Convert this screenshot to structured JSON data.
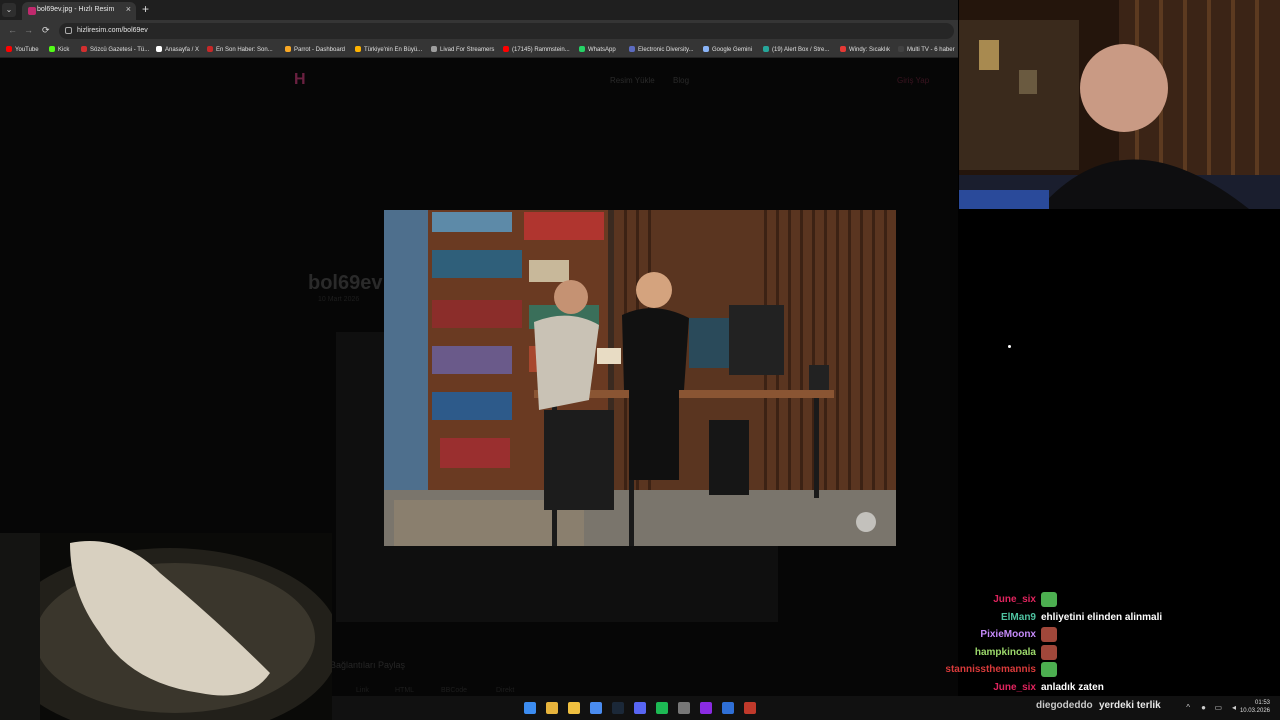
{
  "browser": {
    "tab_title": "bol69ev.jpg - Hızlı Resim",
    "tab_close": "×",
    "new_tab": "+",
    "tab_list": "⌄",
    "url": "hizliresim.com/bol69ev",
    "nav": {
      "back": "←",
      "forward": "→",
      "reload": "⟳"
    },
    "bookmarks": [
      {
        "label": "YouTube",
        "color": "#ff0000"
      },
      {
        "label": "Kick",
        "color": "#53fc18"
      },
      {
        "label": "Sözcü Gazetesi - Tü...",
        "color": "#d32f2f"
      },
      {
        "label": "Anasayfa / X",
        "color": "#ffffff"
      },
      {
        "label": "En Son Haber: Son...",
        "color": "#c62828"
      },
      {
        "label": "Parrot - Dashboard",
        "color": "#f9a825"
      },
      {
        "label": "Türkiye'nin En Büyü...",
        "color": "#ffb300"
      },
      {
        "label": "Livad For Streamers",
        "color": "#9e9e9e"
      },
      {
        "label": "(17145) Rammstein...",
        "color": "#ff0000"
      },
      {
        "label": "WhatsApp",
        "color": "#25d366"
      },
      {
        "label": "Electronic Diversity...",
        "color": "#5c6bc0"
      },
      {
        "label": "Google Gemini",
        "color": "#8ab4f8"
      },
      {
        "label": "(19) Alert Box / Stre...",
        "color": "#26a69a"
      },
      {
        "label": "Windy: Sıcaklık",
        "color": "#e53935"
      },
      {
        "label": "Multi TV - 6 haber",
        "color": "#424242"
      }
    ]
  },
  "page": {
    "logo": "H",
    "nav_links": [
      "Resim Yükle",
      "Blog"
    ],
    "login": "Giriş Yap",
    "title": "bol69ev",
    "date": "10 Mart 2026",
    "share_label": "Bağlantıları Paylaş",
    "share_buttons": [
      "Link",
      "HTML",
      "BBCode",
      "Direkt"
    ]
  },
  "chat": [
    {
      "user": "June_six",
      "color": "#e0245e",
      "message": "",
      "emote": "pepe-emote"
    },
    {
      "user": "ElMan9",
      "color": "#4fc3a1",
      "message": "ehliyetini elinden alinmali",
      "emote": ""
    },
    {
      "user": "PixieMoonx",
      "color": "#c58af9",
      "message": "",
      "emote": "face-emote"
    },
    {
      "user": "hampkinoala",
      "color": "#9cd86b",
      "message": "",
      "emote": "face-emote"
    },
    {
      "user": "stannissthemannis",
      "color": "#d83a3a",
      "message": "",
      "emote": "pepe-emote"
    },
    {
      "user": "June_six",
      "color": "#e0245e",
      "message": "anladık zaten",
      "emote": ""
    }
  ],
  "overlay": {
    "user": "diegodeddo",
    "message": "yerdeki terlik"
  },
  "taskbar": {
    "icons": [
      "windows-icon",
      "chrome-icon",
      "files-icon",
      "app-icon",
      "steam-icon",
      "discord-icon",
      "spotify-icon",
      "calculator-icon",
      "next-icon",
      "store-icon",
      "recorder-icon"
    ],
    "time": "01:53",
    "date": "10.03.2026"
  }
}
